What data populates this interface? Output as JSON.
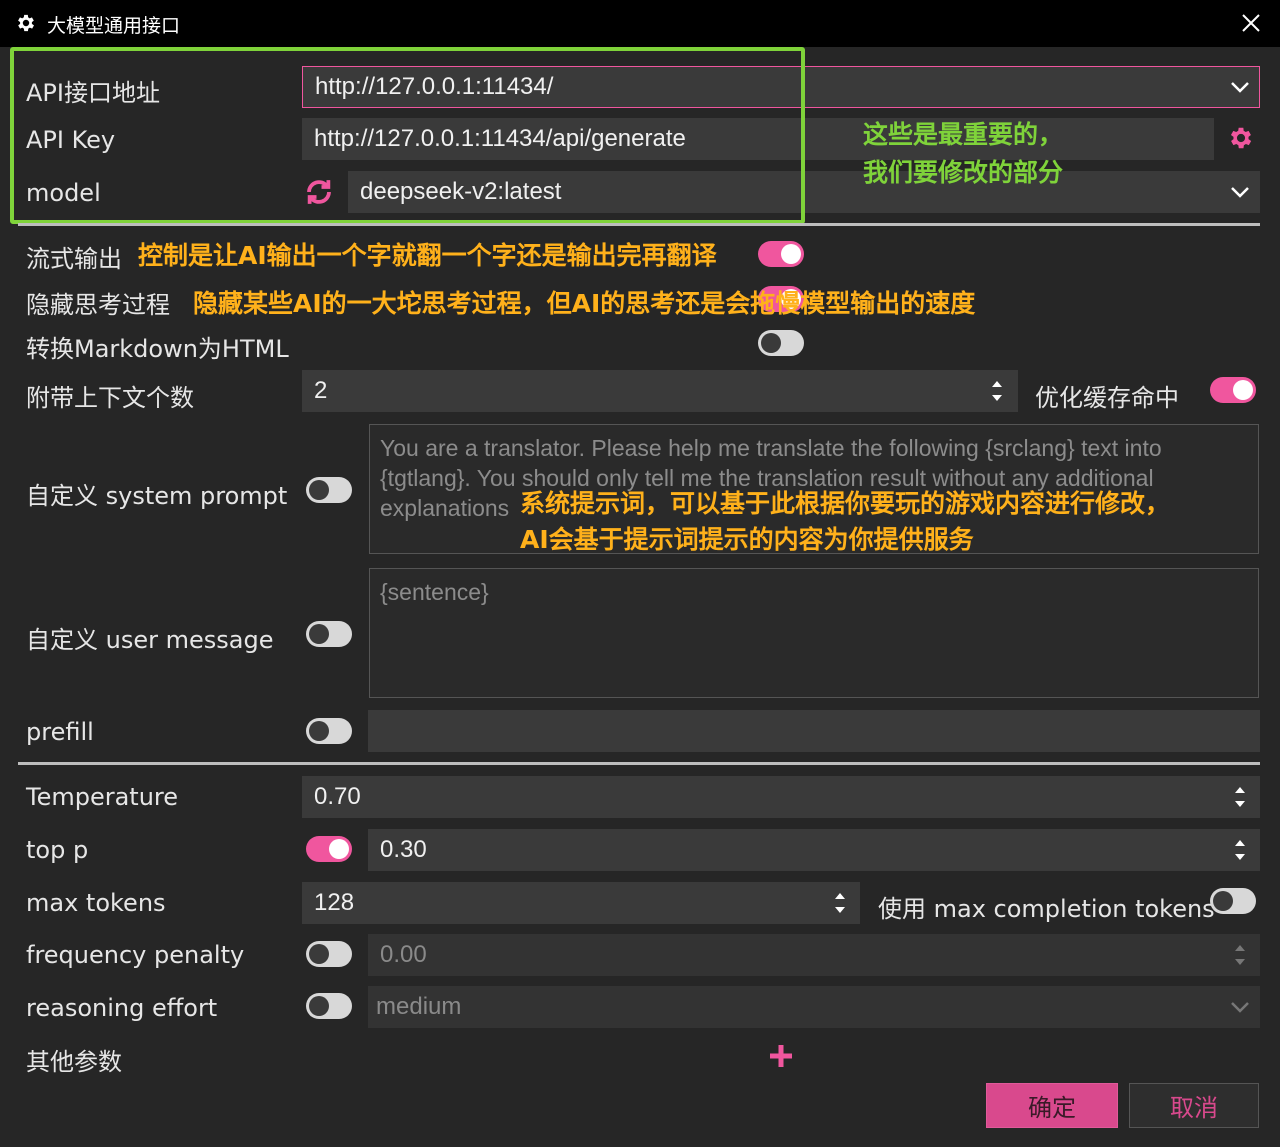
{
  "window": {
    "title": "大模型通用接口"
  },
  "fields": {
    "api_url": {
      "label": "API接口地址",
      "value": "http://127.0.0.1:11434/"
    },
    "api_key": {
      "label": "API Key",
      "value": "http://127.0.0.1:11434/api/generate"
    },
    "model": {
      "label": "model",
      "value": "deepseek-v2:latest"
    }
  },
  "toggles": {
    "stream": {
      "label": "流式输出",
      "on": true
    },
    "hide_thinking": {
      "label": "隐藏思考过程",
      "on": true
    },
    "markdown": {
      "label": "转换Markdown为HTML",
      "on": false
    },
    "cache_hit": {
      "label": "优化缓存命中",
      "on": true
    }
  },
  "context": {
    "label": "附带上下文个数",
    "value": "2"
  },
  "system_prompt": {
    "label": "自定义 system prompt",
    "placeholder": "You are a translator. Please help me translate the following {srclang} text into {tgtlang}. You should only tell me the translation result without any additional explanations"
  },
  "user_message": {
    "label": "自定义 user message",
    "placeholder": "{sentence}"
  },
  "prefill": {
    "label": "prefill",
    "value": ""
  },
  "params": {
    "temperature": {
      "label": "Temperature",
      "value": "0.70"
    },
    "top_p": {
      "label": "top p",
      "value": "0.30"
    },
    "max_tokens": {
      "label": "max tokens",
      "value": "128"
    },
    "max_completion": {
      "label": "使用 max completion tokens"
    },
    "frequency_penalty": {
      "label": "frequency penalty",
      "value": "0.00"
    },
    "reasoning_effort": {
      "label": "reasoning effort",
      "value": "medium"
    },
    "other": {
      "label": "其他参数"
    }
  },
  "buttons": {
    "ok": "确定",
    "cancel": "取消"
  },
  "annotations": {
    "important_line1": "这些是最重要的，",
    "important_line2": "我们要修改的部分",
    "stream_note": "控制是让AI输出一个字就翻一个字还是输出完再翻译",
    "thinking_note": "隐藏某些AI的一大坨思考过程，但AI的思考还是会拖慢模型输出的速度",
    "prompt_note_line1": "系统提示词，可以基于此根据你要玩的游戏内容进行修改，",
    "prompt_note_line2": "AI会基于提示词提示的内容为你提供服务"
  },
  "colors": {
    "accent": "#f0569e",
    "annotation_orange": "#ffb11b",
    "annotation_green": "#7fd33a"
  }
}
